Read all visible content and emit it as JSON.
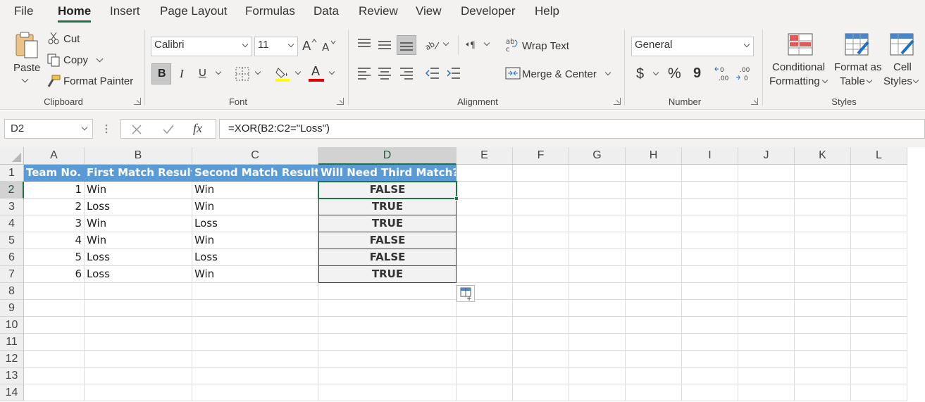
{
  "menu": {
    "tabs": [
      "File",
      "Home",
      "Insert",
      "Page Layout",
      "Formulas",
      "Data",
      "Review",
      "View",
      "Developer",
      "Help"
    ],
    "active": "Home"
  },
  "ribbon": {
    "clipboard": {
      "paste": "Paste",
      "cut": "Cut",
      "copy": "Copy",
      "format_painter": "Format Painter",
      "label": "Clipboard"
    },
    "font": {
      "name": "Calibri",
      "size": "11",
      "bold": "B",
      "italic": "I",
      "underline": "U",
      "font_color_glyph": "A",
      "label": "Font",
      "highlight_color": "#ffff00",
      "font_color": "#e00000"
    },
    "alignment": {
      "wrap_text": "Wrap Text",
      "merge_center": "Merge & Center",
      "label": "Alignment"
    },
    "number": {
      "format": "General",
      "currency": "$",
      "percent": "%",
      "comma": "9",
      "label": "Number"
    },
    "styles": {
      "conditional_1": "Conditional",
      "conditional_2": "Formatting",
      "format_table_1": "Format as",
      "format_table_2": "Table",
      "cell_styles_1": "Cell",
      "cell_styles_2": "Styles",
      "label": "Styles"
    }
  },
  "formula_bar": {
    "name_box": "D2",
    "formula": "=XOR(B2:C2=\"Loss\")",
    "fx": "fx"
  },
  "sheet": {
    "columns": [
      "A",
      "B",
      "C",
      "D",
      "E",
      "F",
      "G",
      "H",
      "I",
      "J",
      "K",
      "L"
    ],
    "rows": [
      "1",
      "2",
      "3",
      "4",
      "5",
      "6",
      "7",
      "8",
      "9",
      "10",
      "11",
      "12",
      "13",
      "14"
    ],
    "header_row": [
      "Team No.",
      "First Match Result",
      "Second Match Result",
      "Will Need Third Match?"
    ],
    "data": [
      [
        "1",
        "Win",
        "Win",
        "FALSE"
      ],
      [
        "2",
        "Loss",
        "Win",
        "TRUE"
      ],
      [
        "3",
        "Win",
        "Loss",
        "TRUE"
      ],
      [
        "4",
        "Win",
        "Win",
        "FALSE"
      ],
      [
        "5",
        "Loss",
        "Loss",
        "FALSE"
      ],
      [
        "6",
        "Loss",
        "Win",
        "TRUE"
      ]
    ],
    "selected_cell": "D2",
    "header_fill": "#5b9bd5",
    "accent": "#217346"
  }
}
